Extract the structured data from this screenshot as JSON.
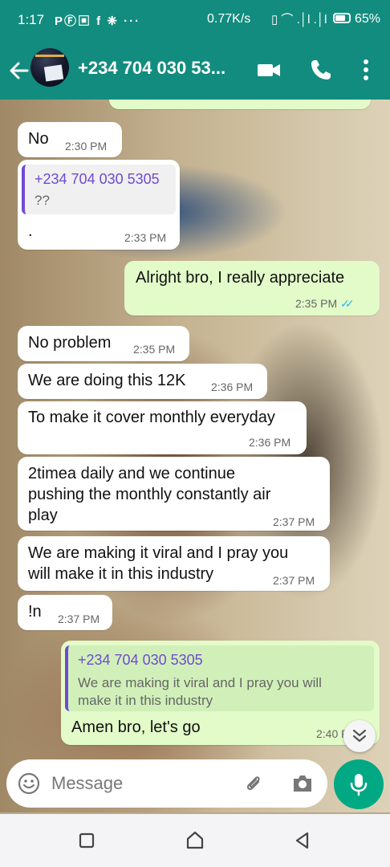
{
  "status_bar": {
    "time": "1:17",
    "app_icons": "PⒻ▣ f ❈ ···",
    "network": "0.77K/s",
    "signal": "▯ ⌒ .│l .│l",
    "battery": "65%"
  },
  "header": {
    "title": "+234 704 030 53..."
  },
  "messages": [
    {
      "text": "No",
      "time": "2:30 PM"
    },
    {
      "quote_name": "+234 704 030 5305",
      "quote_text": "??",
      "text": ".",
      "time": "2:33 PM"
    },
    {
      "text": "Alright bro, I really appreciate",
      "time": "2:35 PM",
      "status": "✓✓"
    },
    {
      "text": "No problem",
      "time": "2:35 PM"
    },
    {
      "text": "We are doing this 12K",
      "time": "2:36 PM"
    },
    {
      "text": "To make it cover monthly everyday",
      "time": "2:36 PM"
    },
    {
      "line1": "2timea daily and we continue",
      "line2": "pushing the monthly constantly air",
      "line3": "play",
      "time": "2:37 PM"
    },
    {
      "line1": "We are making it viral and I pray you",
      "line2": "will make it in this industry",
      "time": "2:37 PM"
    },
    {
      "text": "!n",
      "time": "2:37 PM"
    },
    {
      "quote_name": "+234 704 030 5305",
      "quote_line1": "We are making it viral and I pray you will",
      "quote_line2": "make it in this industry",
      "text": "Amen bro, let's go",
      "time": "2:40 PM"
    }
  ],
  "compose": {
    "placeholder": "Message"
  },
  "colors": {
    "header": "#128c7e",
    "incoming": "#ffffff",
    "outgoing": "#e2fbc9",
    "quote_accent": "#6f4bd1",
    "read_tick": "#34b7f1",
    "mic": "#00a884"
  }
}
